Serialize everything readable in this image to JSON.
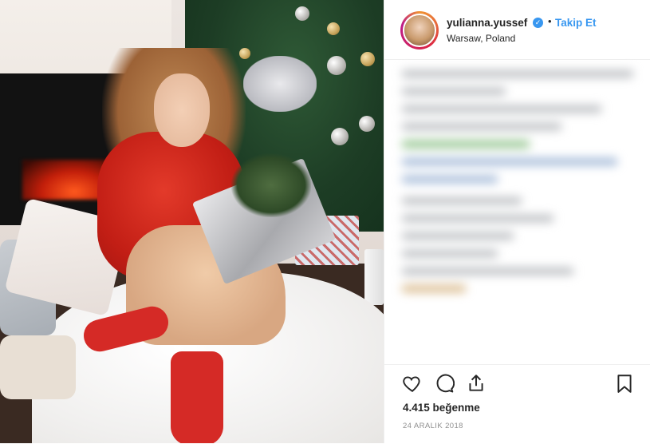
{
  "post": {
    "image_alt": "",
    "header": {
      "username": "yulianna.yussef",
      "verified_icon": "verified-badge-icon",
      "separator": "•",
      "follow_label": "Takip Et",
      "location": "Warsaw, Poland"
    },
    "actions": {
      "like_icon": "heart-icon",
      "comment_icon": "comment-icon",
      "share_icon": "share-icon",
      "save_icon": "bookmark-icon"
    },
    "likes_text": "4.415 beğenme",
    "date_text": "24 ARALIK 2018",
    "colors": {
      "accent_blue": "#3897f0",
      "text_dark": "#262626",
      "text_muted": "#8e8e8e"
    }
  }
}
